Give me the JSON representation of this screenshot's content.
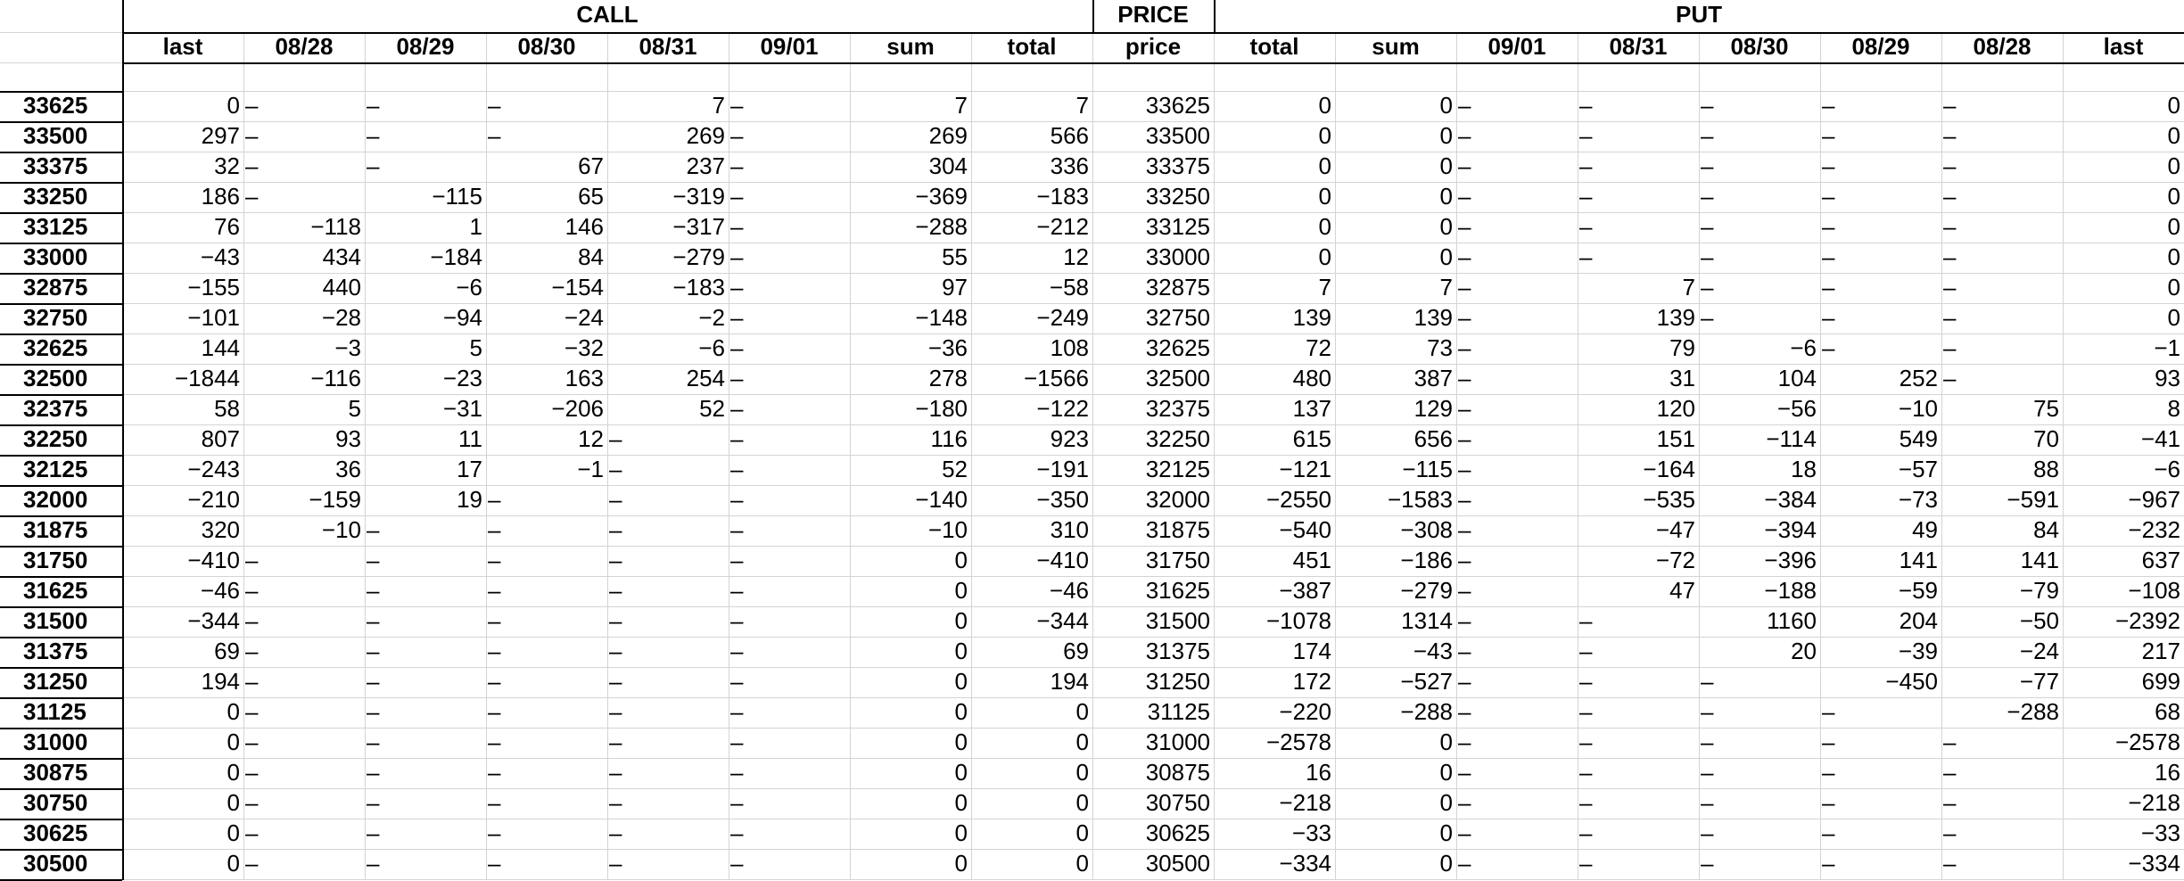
{
  "groups": {
    "call": "CALL",
    "price": "PRICE",
    "put": "PUT"
  },
  "columns": [
    "last",
    "08/28",
    "08/29",
    "08/30",
    "08/31",
    "09/01",
    "sum",
    "total",
    "price",
    "total",
    "sum",
    "09/01",
    "08/31",
    "08/30",
    "08/29",
    "08/28",
    "last"
  ],
  "rows": [
    {
      "label": "33625",
      "cells": [
        "0",
        "–",
        "–",
        "–",
        "7",
        "–",
        "7",
        "7",
        "33625",
        "0",
        "0",
        "–",
        "–",
        "–",
        "–",
        "–",
        "0"
      ]
    },
    {
      "label": "33500",
      "cells": [
        "297",
        "–",
        "–",
        "–",
        "269",
        "–",
        "269",
        "566",
        "33500",
        "0",
        "0",
        "–",
        "–",
        "–",
        "–",
        "–",
        "0"
      ]
    },
    {
      "label": "33375",
      "cells": [
        "32",
        "–",
        "–",
        "67",
        "237",
        "–",
        "304",
        "336",
        "33375",
        "0",
        "0",
        "–",
        "–",
        "–",
        "–",
        "–",
        "0"
      ]
    },
    {
      "label": "33250",
      "cells": [
        "186",
        "–",
        "−115",
        "65",
        "−319",
        "–",
        "−369",
        "−183",
        "33250",
        "0",
        "0",
        "–",
        "–",
        "–",
        "–",
        "–",
        "0"
      ]
    },
    {
      "label": "33125",
      "cells": [
        "76",
        "−118",
        "1",
        "146",
        "−317",
        "–",
        "−288",
        "−212",
        "33125",
        "0",
        "0",
        "–",
        "–",
        "–",
        "–",
        "–",
        "0"
      ]
    },
    {
      "label": "33000",
      "cells": [
        "−43",
        "434",
        "−184",
        "84",
        "−279",
        "–",
        "55",
        "12",
        "33000",
        "0",
        "0",
        "–",
        "–",
        "–",
        "–",
        "–",
        "0"
      ]
    },
    {
      "label": "32875",
      "cells": [
        "−155",
        "440",
        "−6",
        "−154",
        "−183",
        "–",
        "97",
        "−58",
        "32875",
        "7",
        "7",
        "–",
        "7",
        "–",
        "–",
        "–",
        "0"
      ]
    },
    {
      "label": "32750",
      "cells": [
        "−101",
        "−28",
        "−94",
        "−24",
        "−2",
        "–",
        "−148",
        "−249",
        "32750",
        "139",
        "139",
        "–",
        "139",
        "–",
        "–",
        "–",
        "0"
      ]
    },
    {
      "label": "32625",
      "cells": [
        "144",
        "−3",
        "5",
        "−32",
        "−6",
        "–",
        "−36",
        "108",
        "32625",
        "72",
        "73",
        "–",
        "79",
        "−6",
        "–",
        "–",
        "−1"
      ]
    },
    {
      "label": "32500",
      "cells": [
        "−1844",
        "−116",
        "−23",
        "163",
        "254",
        "–",
        "278",
        "−1566",
        "32500",
        "480",
        "387",
        "–",
        "31",
        "104",
        "252",
        "–",
        "93"
      ]
    },
    {
      "label": "32375",
      "cells": [
        "58",
        "5",
        "−31",
        "−206",
        "52",
        "–",
        "−180",
        "−122",
        "32375",
        "137",
        "129",
        "–",
        "120",
        "−56",
        "−10",
        "75",
        "8"
      ]
    },
    {
      "label": "32250",
      "cells": [
        "807",
        "93",
        "11",
        "12",
        "–",
        "–",
        "116",
        "923",
        "32250",
        "615",
        "656",
        "–",
        "151",
        "−114",
        "549",
        "70",
        "−41"
      ]
    },
    {
      "label": "32125",
      "cells": [
        "−243",
        "36",
        "17",
        "−1",
        "–",
        "–",
        "52",
        "−191",
        "32125",
        "−121",
        "−115",
        "–",
        "−164",
        "18",
        "−57",
        "88",
        "−6"
      ]
    },
    {
      "label": "32000",
      "cells": [
        "−210",
        "−159",
        "19",
        "–",
        "–",
        "–",
        "−140",
        "−350",
        "32000",
        "−2550",
        "−1583",
        "–",
        "−535",
        "−384",
        "−73",
        "−591",
        "−967"
      ]
    },
    {
      "label": "31875",
      "cells": [
        "320",
        "−10",
        "–",
        "–",
        "–",
        "–",
        "−10",
        "310",
        "31875",
        "−540",
        "−308",
        "–",
        "−47",
        "−394",
        "49",
        "84",
        "−232"
      ]
    },
    {
      "label": "31750",
      "cells": [
        "−410",
        "–",
        "–",
        "–",
        "–",
        "–",
        "0",
        "−410",
        "31750",
        "451",
        "−186",
        "–",
        "−72",
        "−396",
        "141",
        "141",
        "637"
      ]
    },
    {
      "label": "31625",
      "cells": [
        "−46",
        "–",
        "–",
        "–",
        "–",
        "–",
        "0",
        "−46",
        "31625",
        "−387",
        "−279",
        "–",
        "47",
        "−188",
        "−59",
        "−79",
        "−108"
      ]
    },
    {
      "label": "31500",
      "cells": [
        "−344",
        "–",
        "–",
        "–",
        "–",
        "–",
        "0",
        "−344",
        "31500",
        "−1078",
        "1314",
        "–",
        "–",
        "1160",
        "204",
        "−50",
        "−2392"
      ]
    },
    {
      "label": "31375",
      "cells": [
        "69",
        "–",
        "–",
        "–",
        "–",
        "–",
        "0",
        "69",
        "31375",
        "174",
        "−43",
        "–",
        "–",
        "20",
        "−39",
        "−24",
        "217"
      ]
    },
    {
      "label": "31250",
      "cells": [
        "194",
        "–",
        "–",
        "–",
        "–",
        "–",
        "0",
        "194",
        "31250",
        "172",
        "−527",
        "–",
        "–",
        "–",
        "−450",
        "−77",
        "699"
      ]
    },
    {
      "label": "31125",
      "cells": [
        "0",
        "–",
        "–",
        "–",
        "–",
        "–",
        "0",
        "0",
        "31125",
        "−220",
        "−288",
        "–",
        "–",
        "–",
        "–",
        "−288",
        "68"
      ]
    },
    {
      "label": "31000",
      "cells": [
        "0",
        "–",
        "–",
        "–",
        "–",
        "–",
        "0",
        "0",
        "31000",
        "−2578",
        "0",
        "–",
        "–",
        "–",
        "–",
        "–",
        "−2578"
      ]
    },
    {
      "label": "30875",
      "cells": [
        "0",
        "–",
        "–",
        "–",
        "–",
        "–",
        "0",
        "0",
        "30875",
        "16",
        "0",
        "–",
        "–",
        "–",
        "–",
        "–",
        "16"
      ]
    },
    {
      "label": "30750",
      "cells": [
        "0",
        "–",
        "–",
        "–",
        "–",
        "–",
        "0",
        "0",
        "30750",
        "−218",
        "0",
        "–",
        "–",
        "–",
        "–",
        "–",
        "−218"
      ]
    },
    {
      "label": "30625",
      "cells": [
        "0",
        "–",
        "–",
        "–",
        "–",
        "–",
        "0",
        "0",
        "30625",
        "−33",
        "0",
        "–",
        "–",
        "–",
        "–",
        "–",
        "−33"
      ]
    },
    {
      "label": "30500",
      "cells": [
        "0",
        "–",
        "–",
        "–",
        "–",
        "–",
        "0",
        "0",
        "30500",
        "−334",
        "0",
        "–",
        "–",
        "–",
        "–",
        "–",
        "−334"
      ]
    }
  ]
}
